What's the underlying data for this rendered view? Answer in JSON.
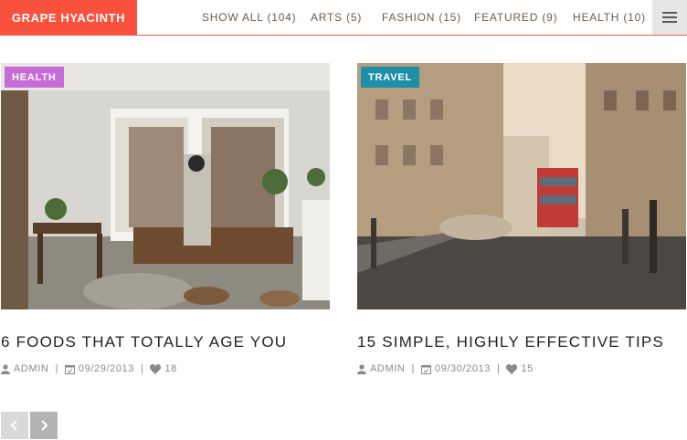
{
  "brand": "GRAPE HYACINTH",
  "nav": {
    "items": [
      {
        "label": "SHOW ALL (104)"
      },
      {
        "label": "ARTS (5)"
      },
      {
        "label": "FASHION (15)"
      },
      {
        "label": "FEATURED (9)"
      },
      {
        "label": "HEALTH (10)"
      }
    ],
    "menu_icon": "hamburger-icon"
  },
  "posts": [
    {
      "category": "HEALTH",
      "category_color": "#c86ad8",
      "title": "6 FOODS THAT TOTALLY AGE YOU",
      "author": "ADMIN",
      "date": "09/29/2013",
      "likes": "18"
    },
    {
      "category": "TRAVEL",
      "category_color": "#1e8fa8",
      "title": "15 SIMPLE, HIGHLY EFFECTIVE TIPS",
      "author": "ADMIN",
      "date": "09/30/2013",
      "likes": "15"
    }
  ],
  "pagination": {
    "prev_icon": "chevron-left-icon",
    "next_icon": "chevron-right-icon"
  },
  "colors": {
    "brand_bg": "#f8523e",
    "nav_text": "#6b5c53",
    "pager_prev": "#d9d9d9",
    "pager_next": "#b3b3b3"
  }
}
